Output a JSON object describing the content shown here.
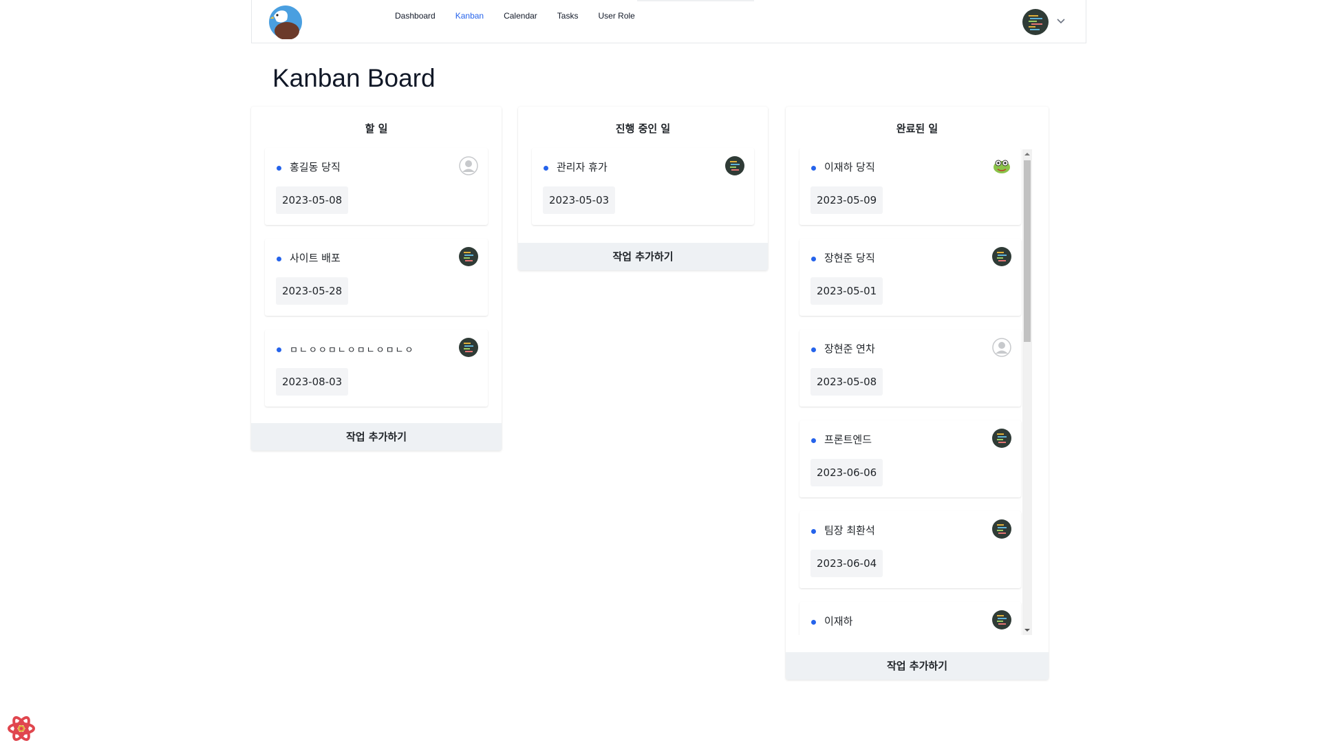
{
  "nav": {
    "items": [
      {
        "label": "Dashboard",
        "active": false
      },
      {
        "label": "Kanban",
        "active": true
      },
      {
        "label": "Calendar",
        "active": false
      },
      {
        "label": "Tasks",
        "active": false
      },
      {
        "label": "User Role",
        "active": false
      }
    ],
    "user_menu_icon": "chevron-down-icon"
  },
  "page": {
    "title": "Kanban Board"
  },
  "columns": [
    {
      "title": "할 일",
      "add_label": "작업 추가하기",
      "cards": [
        {
          "title": "홍길동 당직",
          "date": "2023-05-08",
          "avatar": "default-user-icon"
        },
        {
          "title": "사이트 배포",
          "date": "2023-05-28",
          "avatar": "code-avatar"
        },
        {
          "title": "ㅁㄴㅇㅇㅁㄴㅇㅁㄴㅇㅁㄴㅇ",
          "date": "2023-08-03",
          "avatar": "code-avatar"
        }
      ]
    },
    {
      "title": "진행 중인 일",
      "add_label": "작업 추가하기",
      "cards": [
        {
          "title": "관리자 휴가",
          "date": "2023-05-03",
          "avatar": "code-avatar"
        }
      ]
    },
    {
      "title": "완료된 일",
      "add_label": "작업 추가하기",
      "cards": [
        {
          "title": "이재하 당직",
          "date": "2023-05-09",
          "avatar": "frog-avatar"
        },
        {
          "title": "장현준 당직",
          "date": "2023-05-01",
          "avatar": "code-avatar"
        },
        {
          "title": "장현준 연차",
          "date": "2023-05-08",
          "avatar": "default-user-icon"
        },
        {
          "title": "프론트엔드",
          "date": "2023-06-06",
          "avatar": "code-avatar"
        },
        {
          "title": "팀장 최환석",
          "date": "2023-06-04",
          "avatar": "code-avatar"
        },
        {
          "title": "이재하",
          "date": "",
          "avatar": "code-avatar"
        }
      ]
    }
  ],
  "colors": {
    "accent": "#2563eb",
    "button_bg": "#eef1f4",
    "date_bg": "#f3f4f6"
  }
}
